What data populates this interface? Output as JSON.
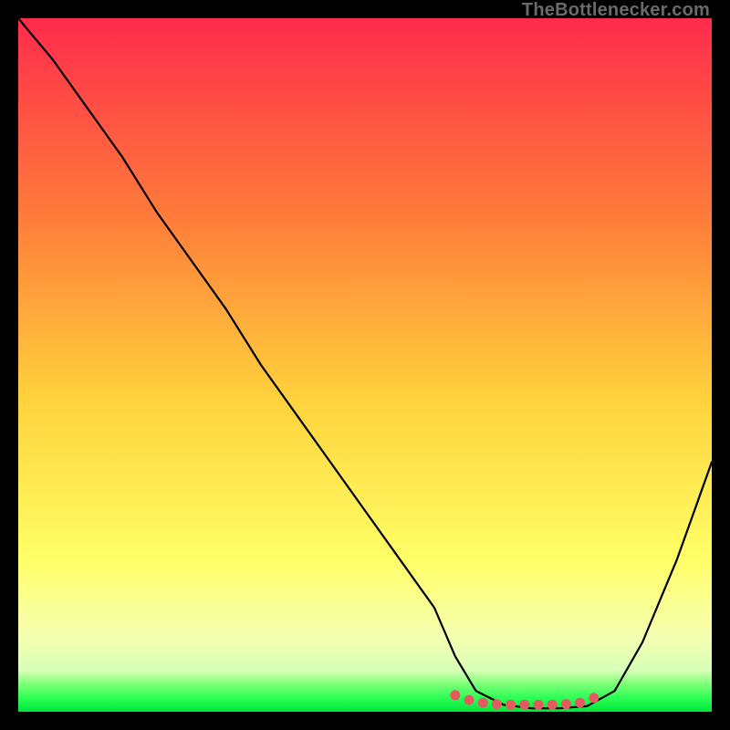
{
  "watermark": "TheBottlenecker.com",
  "colors": {
    "top": "#ff2b4d",
    "mid_upper": "#ff7a3a",
    "mid": "#ffd23c",
    "mid_lower": "#ffff66",
    "pale": "#f6ffb0",
    "green_light": "#7dff77",
    "green": "#00e53a",
    "curve": "#000000",
    "marker": "#e35b60",
    "frame": "#000000"
  },
  "chart_data": {
    "type": "line",
    "title": "",
    "xlabel": "",
    "ylabel": "",
    "xlim": [
      0,
      100
    ],
    "ylim": [
      0,
      100
    ],
    "series": [
      {
        "name": "bottleneck-curve",
        "x": [
          0,
          5,
          10,
          15,
          20,
          25,
          30,
          35,
          40,
          45,
          50,
          55,
          60,
          63,
          66,
          70,
          74,
          78,
          82,
          86,
          90,
          95,
          100
        ],
        "y": [
          100,
          94,
          87,
          80,
          72,
          65,
          58,
          50,
          43,
          36,
          29,
          22,
          15,
          8,
          3,
          1,
          0.5,
          0.5,
          0.8,
          3,
          10,
          22,
          36
        ]
      }
    ],
    "markers": {
      "name": "flat-region-dots",
      "x": [
        63,
        65,
        67,
        69,
        71,
        73,
        75,
        77,
        79,
        81,
        83
      ],
      "y": [
        2.4,
        1.7,
        1.3,
        1.1,
        1.0,
        1.0,
        1.0,
        1.0,
        1.1,
        1.3,
        2.0
      ]
    }
  }
}
